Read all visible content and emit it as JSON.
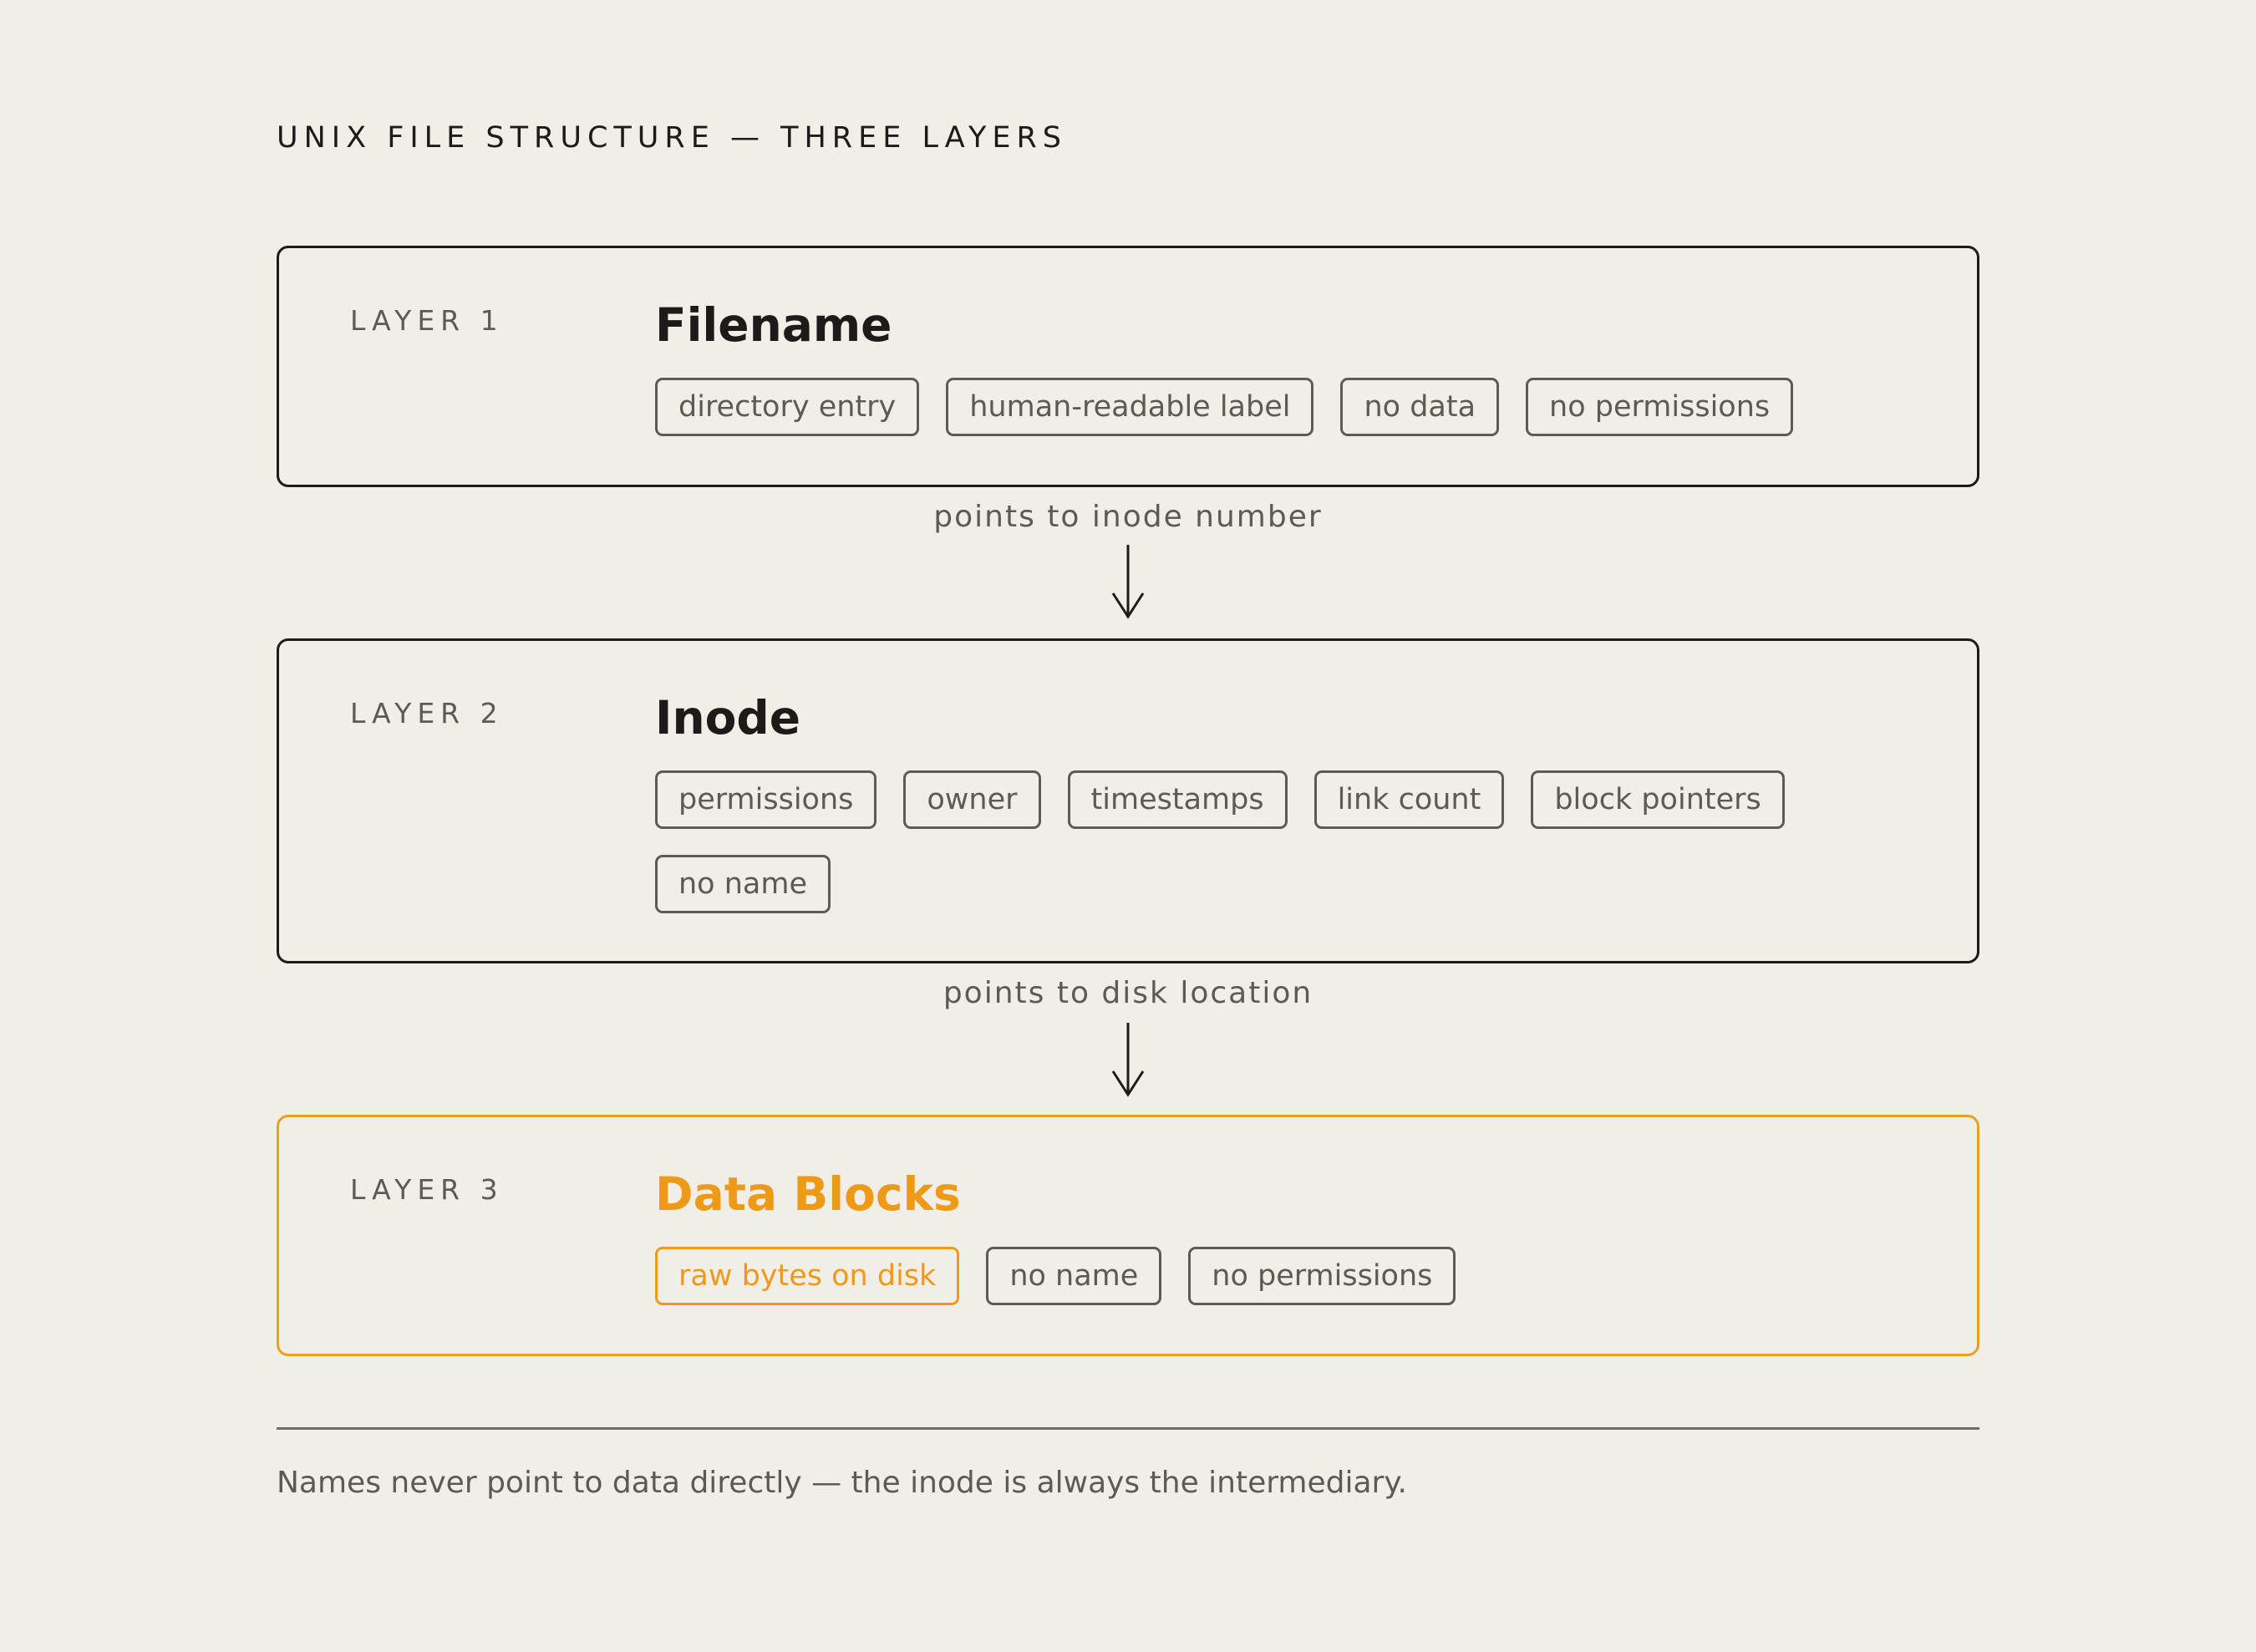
{
  "heading": "UNIX FILE STRUCTURE — THREE LAYERS",
  "colors": {
    "background": "#f1eee8",
    "ink": "#1c1b19",
    "muted": "#5c5a55",
    "accent": "#ec9a17"
  },
  "layers": [
    {
      "label": "LAYER 1",
      "title": "Filename",
      "tags": [
        "directory entry",
        "human-readable label",
        "no data",
        "no permissions"
      ]
    },
    {
      "label": "LAYER 2",
      "title": "Inode",
      "tags": [
        "permissions",
        "owner",
        "timestamps",
        "link count",
        "block pointers",
        "no name"
      ]
    },
    {
      "label": "LAYER 3",
      "title": "Data Blocks",
      "tags": [
        "raw bytes on disk",
        "no name",
        "no permissions"
      ]
    }
  ],
  "connectors": [
    {
      "label": "points to inode number",
      "icon": "down-arrow-icon"
    },
    {
      "label": "points to disk location",
      "icon": "down-arrow-icon"
    }
  ],
  "footnote": "Names never point to data directly — the inode is always the intermediary."
}
